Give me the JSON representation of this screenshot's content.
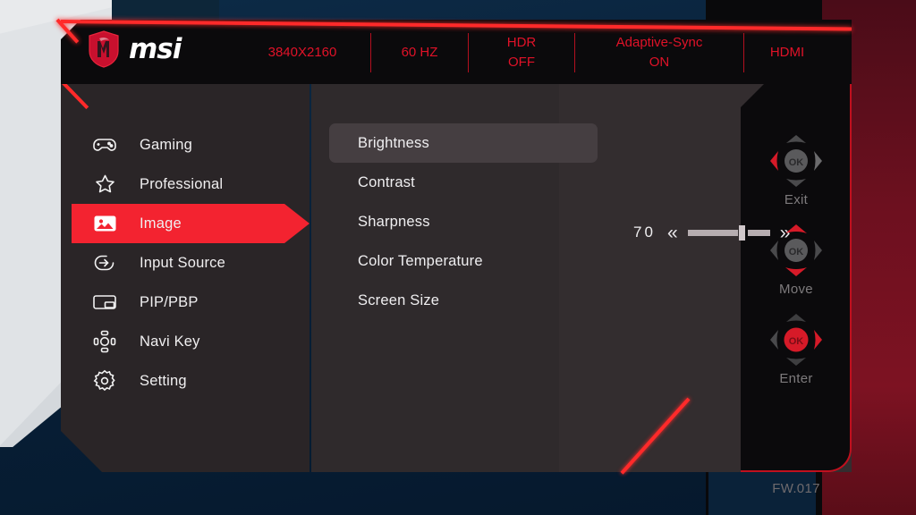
{
  "background": {
    "accent_red": "#ff2a2a",
    "navy": "#0b2239",
    "panel_dark": "#2a2527"
  },
  "osd": {
    "brand": {
      "logo_icon": "msi-dragon-shield-icon",
      "wordmark": "msi"
    },
    "status_bar": [
      {
        "name": "resolution",
        "line1": "3840X2160",
        "line2": ""
      },
      {
        "name": "refresh-rate",
        "line1": "60 HZ",
        "line2": ""
      },
      {
        "name": "hdr",
        "line1": "HDR",
        "line2": "OFF"
      },
      {
        "name": "adaptive-sync",
        "line1": "Adaptive-Sync",
        "line2": "ON"
      },
      {
        "name": "input",
        "line1": "HDMI",
        "line2": ""
      }
    ],
    "sidebar": {
      "items": [
        {
          "label": "Gaming",
          "icon": "gamepad-icon",
          "active": false
        },
        {
          "label": "Professional",
          "icon": "star-icon",
          "active": false
        },
        {
          "label": "Image",
          "icon": "picture-icon",
          "active": true
        },
        {
          "label": "Input Source",
          "icon": "input-arrow-icon",
          "active": false
        },
        {
          "label": "PIP/PBP",
          "icon": "pip-pbp-icon",
          "active": false
        },
        {
          "label": "Navi Key",
          "icon": "navi-key-icon",
          "active": false
        },
        {
          "label": "Setting",
          "icon": "gear-icon",
          "active": false
        }
      ]
    },
    "submenu": {
      "items": [
        {
          "label": "Brightness",
          "selected": true
        },
        {
          "label": "Contrast",
          "selected": false
        },
        {
          "label": "Sharpness",
          "selected": false
        },
        {
          "label": "Color Temperature",
          "selected": false
        },
        {
          "label": "Screen Size",
          "selected": false
        }
      ]
    },
    "value_control": {
      "setting": "Brightness",
      "value": "70",
      "value_number": 70,
      "min": 0,
      "max": 100,
      "decrease_icon": "double-chevron-left-icon",
      "increase_icon": "double-chevron-right-icon",
      "decrease_glyph": "«",
      "increase_glyph": "»"
    },
    "nav_hints": [
      {
        "label": "Exit",
        "icon": "dpad-left-icon",
        "highlight": "left"
      },
      {
        "label": "Move",
        "icon": "dpad-updown-icon",
        "highlight": "updown"
      },
      {
        "label": "Enter",
        "icon": "dpad-enter-icon",
        "highlight": "enter"
      }
    ],
    "firmware": "FW.017"
  }
}
